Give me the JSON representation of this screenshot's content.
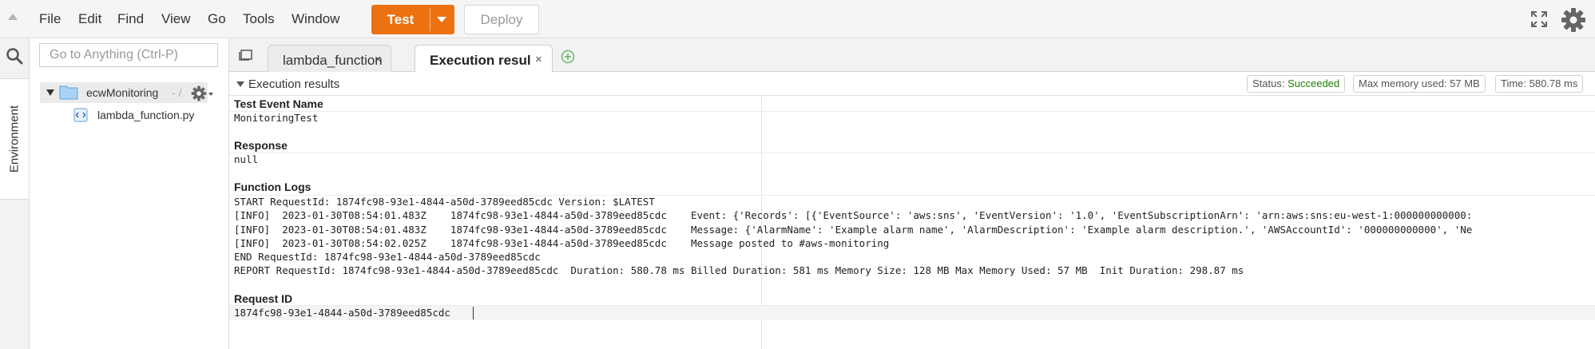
{
  "menubar": {
    "items": [
      "File",
      "Edit",
      "Find",
      "View",
      "Go",
      "Tools",
      "Window"
    ],
    "test_label": "Test",
    "deploy_label": "Deploy",
    "accent_color": "#ec7211"
  },
  "sidebar": {
    "tab_label": "Environment",
    "goto_placeholder": "Go to Anything (Ctrl-P)"
  },
  "file_tree": {
    "root_name": "ecwMonitoring",
    "root_suffix": "- /",
    "file_name": "lambda_function.py"
  },
  "editor_tabs": [
    {
      "label": "lambda_function",
      "close": "×"
    },
    {
      "label": "Execution results",
      "close": "×"
    }
  ],
  "results": {
    "header": "Execution results",
    "status_label": "Status:",
    "status_value": "Succeeded",
    "status_color": "#1d8102",
    "memory_badge": "Max memory used: 57 MB",
    "time_badge": "Time: 580.78 ms",
    "test_event_title": "Test Event Name",
    "test_event_value": "MonitoringTest",
    "response_title": "Response",
    "response_value": "null",
    "logs_title": "Function Logs",
    "log_lines": [
      "START RequestId: 1874fc98-93e1-4844-a50d-3789eed85cdc Version: $LATEST",
      "[INFO]  2023-01-30T08:54:01.483Z    1874fc98-93e1-4844-a50d-3789eed85cdc    Event: {'Records': [{'EventSource': 'aws:sns', 'EventVersion': '1.0', 'EventSubscriptionArn': 'arn:aws:sns:eu-west-1:000000000000:",
      "[INFO]  2023-01-30T08:54:01.483Z    1874fc98-93e1-4844-a50d-3789eed85cdc    Message: {'AlarmName': 'Example alarm name', 'AlarmDescription': 'Example alarm description.', 'AWSAccountId': '000000000000', 'Ne",
      "[INFO]  2023-01-30T08:54:02.025Z    1874fc98-93e1-4844-a50d-3789eed85cdc    Message posted to #aws-monitoring",
      "END RequestId: 1874fc98-93e1-4844-a50d-3789eed85cdc",
      "REPORT RequestId: 1874fc98-93e1-4844-a50d-3789eed85cdc  Duration: 580.78 ms Billed Duration: 581 ms Memory Size: 128 MB Max Memory Used: 57 MB  Init Duration: 298.87 ms"
    ],
    "request_id_title": "Request ID",
    "request_id_value": "1874fc98-93e1-4844-a50d-3789eed85cdc"
  }
}
